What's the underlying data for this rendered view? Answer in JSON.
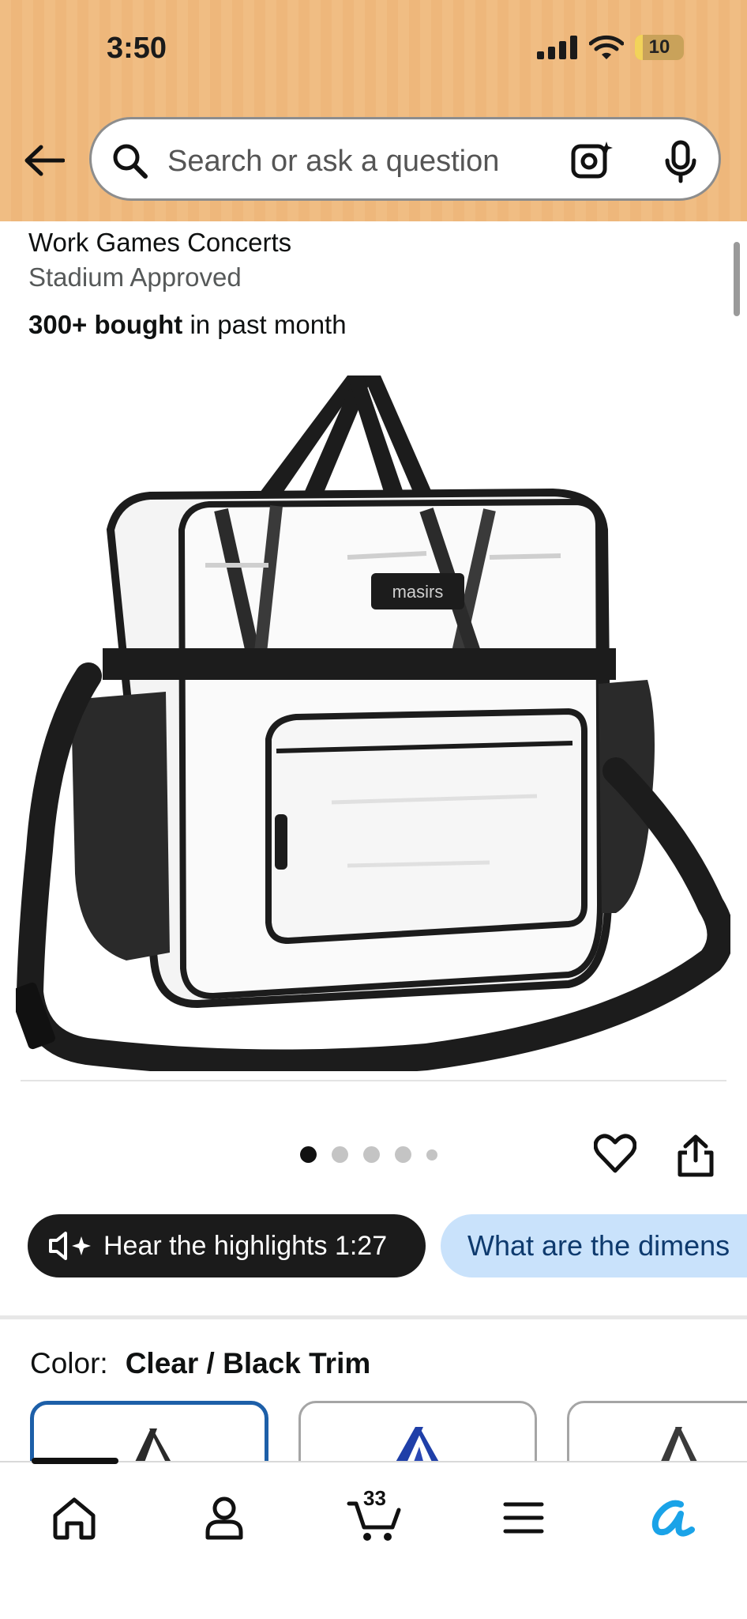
{
  "status_bar": {
    "time": "3:50",
    "battery": "10"
  },
  "search": {
    "placeholder": "Search or ask a question"
  },
  "product": {
    "title_line1": "Work Games Concerts",
    "title_line2": "Stadium Approved",
    "bought_bold": "300+ bought",
    "bought_rest": " in past month",
    "brand_label": "masirs",
    "image_count": 5,
    "active_image_index": 0
  },
  "actions": {
    "hear_highlights": "Hear the highlights 1:27",
    "question_chip": "What are the dimens"
  },
  "color": {
    "label": "Color:",
    "value": "Clear / Black Trim",
    "swatches": [
      "clear-black",
      "clear-blue",
      "clear-gray"
    ]
  },
  "bottom_nav": {
    "items": [
      "home-icon",
      "account-icon",
      "cart-icon",
      "menu-icon",
      "rufus-icon"
    ],
    "cart_count": "33"
  },
  "colors": {
    "header_bg": "#f0bd83",
    "selected_swatch": "#1d5fa8",
    "chip_blue_bg": "#c9e2fb",
    "rufus_blue": "#1aa3e8"
  }
}
